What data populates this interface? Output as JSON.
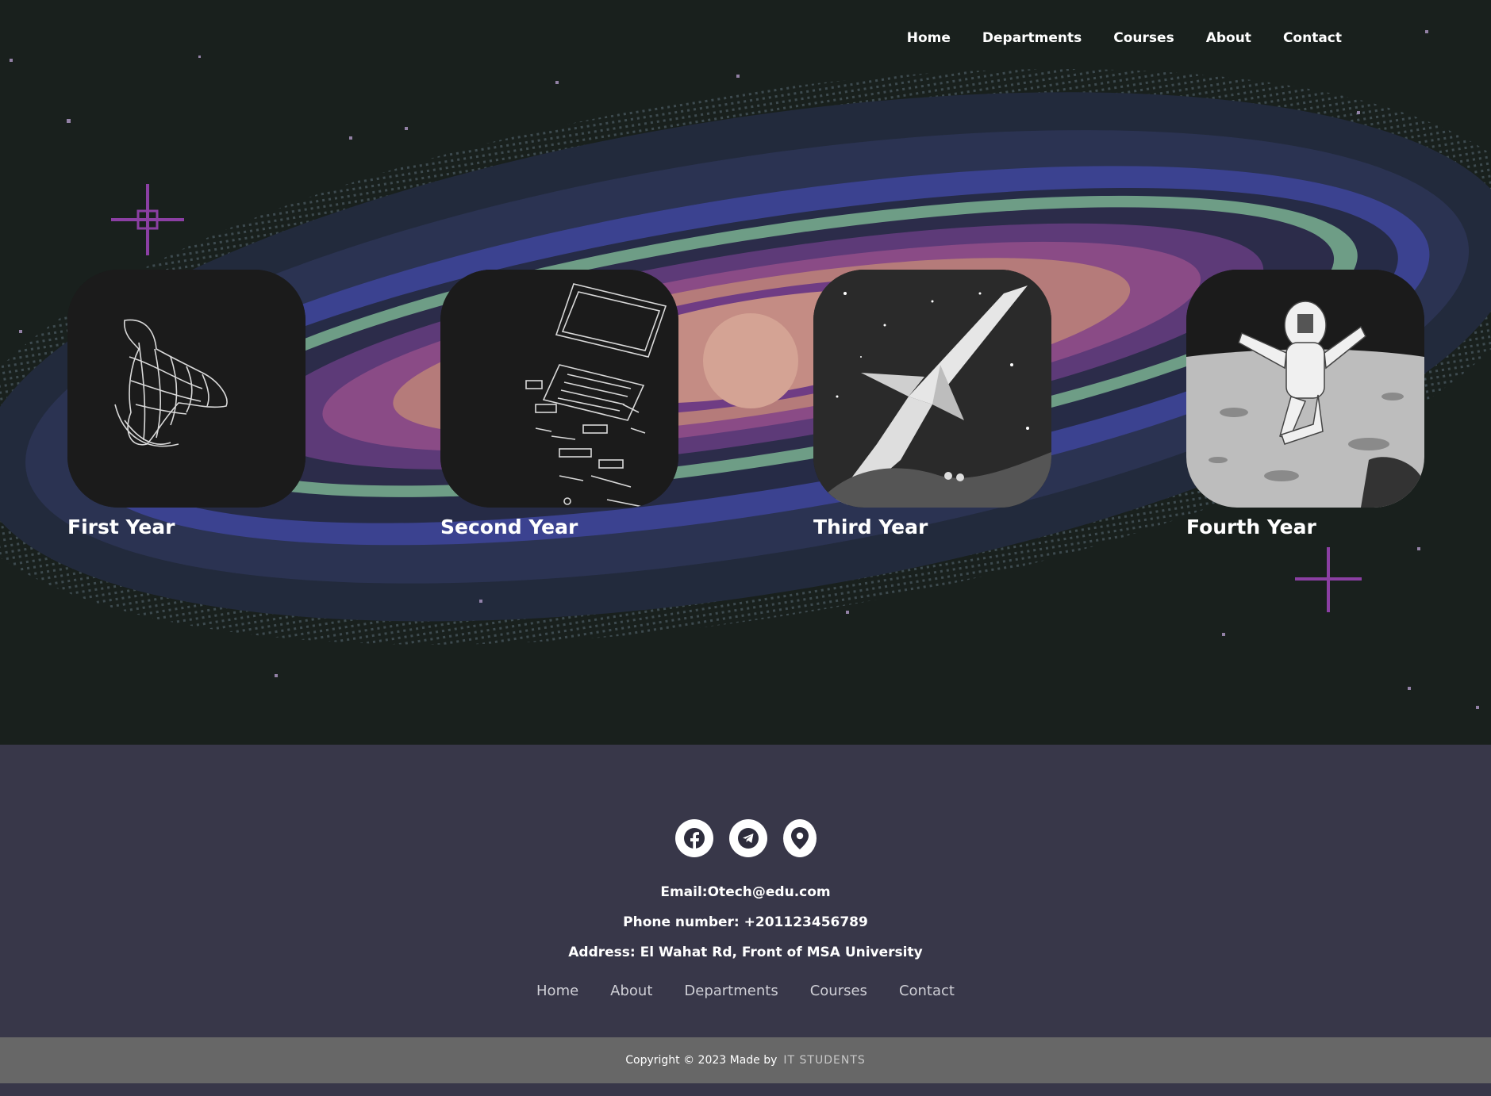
{
  "nav": {
    "items": [
      "Home",
      "Departments",
      "Courses",
      "About",
      "Contact"
    ]
  },
  "years": [
    {
      "label": "First Year",
      "icon": "wireframe-hand-image"
    },
    {
      "label": "Second Year",
      "icon": "exploded-laptop-image"
    },
    {
      "label": "Third Year",
      "icon": "space-shuttle-image"
    },
    {
      "label": "Fourth Year",
      "icon": "astronaut-moon-image"
    }
  ],
  "footer": {
    "social": [
      "facebook-icon",
      "telegram-icon",
      "location-pin-icon"
    ],
    "email": "Email:Otech@edu.com",
    "phone": "Phone number: +201123456789",
    "address": "Address: El Wahat Rd, Front of MSA University",
    "links": [
      "Home",
      "About",
      "Departments",
      "Courses",
      "Contact"
    ],
    "copyright": "Copyright © 2023 Made by",
    "team": "IT STUDENTS"
  },
  "colors": {
    "hero_bg": "#19201d",
    "footer_bg": "#383749",
    "bottom_bar": "#676767"
  }
}
